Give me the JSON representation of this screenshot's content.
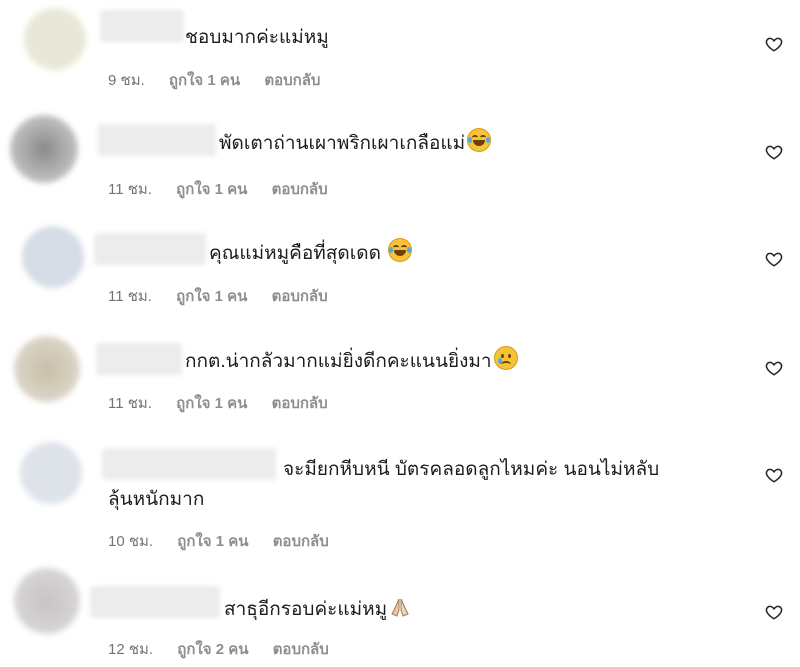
{
  "colors": {
    "text": "#1c1c1c",
    "meta": "#737373",
    "heart_stroke": "#262626"
  },
  "icons": {
    "like": "heart-outline-icon"
  },
  "comments": [
    {
      "text": "ชอบมากค่ะแม่หมู",
      "emoji": "",
      "time": "9 ชม.",
      "likes": "ถูกใจ 1 คน",
      "reply": "ตอบกลับ"
    },
    {
      "text": "พัดเตาถ่านเผาพริกเผาเกลือแม่",
      "emoji": "face-with-tears-of-joy",
      "time": "11 ชม.",
      "likes": "ถูกใจ 1 คน",
      "reply": "ตอบกลับ"
    },
    {
      "text": "คุณแม่หมูคือที่สุดเดด ",
      "emoji": "face-with-tears-of-joy",
      "time": "11 ชม.",
      "likes": "ถูกใจ 1 คน",
      "reply": "ตอบกลับ"
    },
    {
      "text": "กกต.น่ากลัวมากแม่ยิ่งดีกคะแนนยิ่งมา",
      "emoji": "sad-but-relieved-face",
      "time": "11 ชม.",
      "likes": "ถูกใจ 1 คน",
      "reply": "ตอบกลับ"
    },
    {
      "text": "จะมียกหีบหนี บัตรคลอดลูกไหมค่ะ นอนไม่หลับ",
      "text_line2": "ลุ้นหนักมาก",
      "emoji": "",
      "time": "10 ชม.",
      "likes": "ถูกใจ 1 คน",
      "reply": "ตอบกลับ"
    },
    {
      "text": "สาธุอีกรอบค่ะแม่หมู",
      "emoji": "folded-hands",
      "time": "12 ชม.",
      "likes": "ถูกใจ 2 คน",
      "reply": "ตอบกลับ"
    }
  ]
}
